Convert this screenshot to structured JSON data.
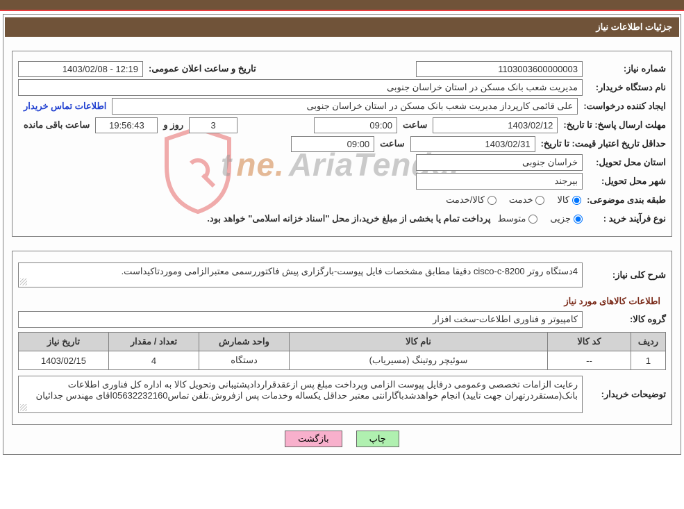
{
  "header": {
    "title": "جزئیات اطلاعات نیاز"
  },
  "info": {
    "need_no_label": "شماره نیاز:",
    "need_no": "1103003600000003",
    "announce_label": "تاریخ و ساعت اعلان عمومی:",
    "announce_val": "12:19 - 1403/02/08",
    "buyer_org_label": "نام دستگاه خریدار:",
    "buyer_org": "مدیریت شعب بانک مسکن در استان خراسان جنوبی",
    "requester_label": "ایجاد کننده درخواست:",
    "requester": "علی قائمی کارپرداز مدیریت شعب بانک مسکن در استان خراسان جنوبی",
    "buyer_contact": "اطلاعات تماس خریدار",
    "deadline_label": "مهلت ارسال پاسخ: تا تاریخ:",
    "deadline_date": "1403/02/12",
    "time_label": "ساعت",
    "deadline_time": "09:00",
    "days_label": "روز و",
    "days_remaining": "3",
    "remaining_time": "19:56:43",
    "remaining_label": "ساعت باقی مانده",
    "validity_label": "حداقل تاریخ اعتبار قیمت: تا تاریخ:",
    "validity_date": "1403/02/31",
    "validity_time": "09:00",
    "province_label": "استان محل تحویل:",
    "province": "خراسان جنوبی",
    "city_label": "شهر محل تحویل:",
    "city": "بیرجند",
    "class_label": "طبقه بندی موضوعی:",
    "class_kala": "کالا",
    "class_khedmat": "خدمت",
    "class_both": "کالا/خدمت",
    "purchase_type_label": "نوع فرآیند خرید :",
    "pt_partial": "جزیی",
    "pt_medium": "متوسط",
    "purchase_note": "پرداخت تمام یا بخشی از مبلغ خرید،از محل \"اسناد خزانه اسلامی\" خواهد بود."
  },
  "detail": {
    "need_desc_label": "شرح کلی نیاز:",
    "need_desc": "4دستگاه روتر cisco-c-8200 دقیقا مطابق مشخصات فایل پیوست-بارگزاری پیش فاکتوررسمی معتبرالزامی وموردتاکیداست.",
    "items_title": "اطلاعات کالاهای مورد نیاز",
    "group_label": "گروه کالا:",
    "group_val": "کامپیوتر و فناوری اطلاعات-سخت افزار",
    "buyer_notes_label": "توضیحات خریدار:",
    "buyer_notes": "رعایت الزامات تخصصی وعمومی درفایل پیوست الزامی وپرداخت مبلغ پس ازعقدقراردادپشتیبانی وتحویل کالا به اداره کل فناوری اطلاعات بانک(مستقردرتهران جهت تایید) انجام خواهدشدباگارانتی معتبر حداقل یکساله وخدمات پس ازفروش.تلفن تماس05632232160اقای مهندس جدائیان"
  },
  "table": {
    "headers": {
      "row": "ردیف",
      "code": "کد کالا",
      "name": "نام کالا",
      "unit": "واحد شمارش",
      "qty": "تعداد / مقدار",
      "date": "تاریخ نیاز"
    },
    "rows": [
      {
        "row": "1",
        "code": "--",
        "name": "سوئیچر روتینگ (مسیریاب)",
        "unit": "دستگاه",
        "qty": "4",
        "date": "1403/02/15"
      }
    ]
  },
  "buttons": {
    "print": "چاپ",
    "back": "بازگشت"
  },
  "watermark": {
    "text1": "AriaTender",
    "text2": ".ne",
    "text3": "t"
  }
}
